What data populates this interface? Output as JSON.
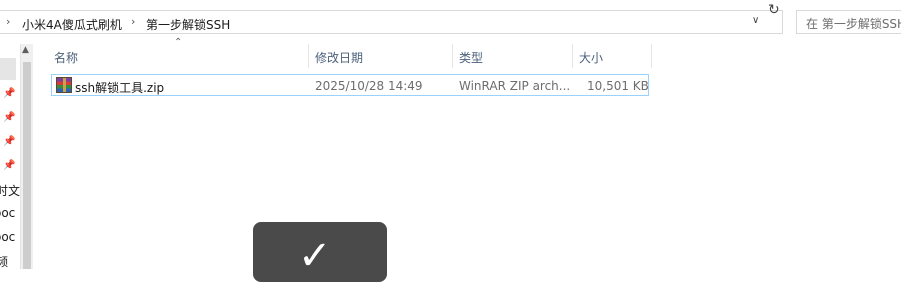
{
  "address_bar": {
    "breadcrumbs": [
      "小米4A傻瓜式刷机",
      "第一步解锁SSH"
    ],
    "separator": "›",
    "dropdown_icon": "chevron-down-icon",
    "refresh_icon": "refresh-icon"
  },
  "search": {
    "placeholder": "在 第一步解锁SSH"
  },
  "nav_pane": {
    "pin_icon": "pin-icon",
    "items": [
      "时文",
      "ooc",
      "ooc",
      "频"
    ]
  },
  "columns": {
    "name": "名称",
    "modified": "修改日期",
    "type": "类型",
    "size": "大小"
  },
  "files": [
    {
      "name": "ssh解锁工具.zip",
      "modified": "2025/10/28 14:49",
      "type": "WinRAR ZIP arch...",
      "size": "10,501 KB",
      "icon": "winrar-zip-icon"
    }
  ],
  "toast": {
    "icon": "checkmark-icon"
  }
}
